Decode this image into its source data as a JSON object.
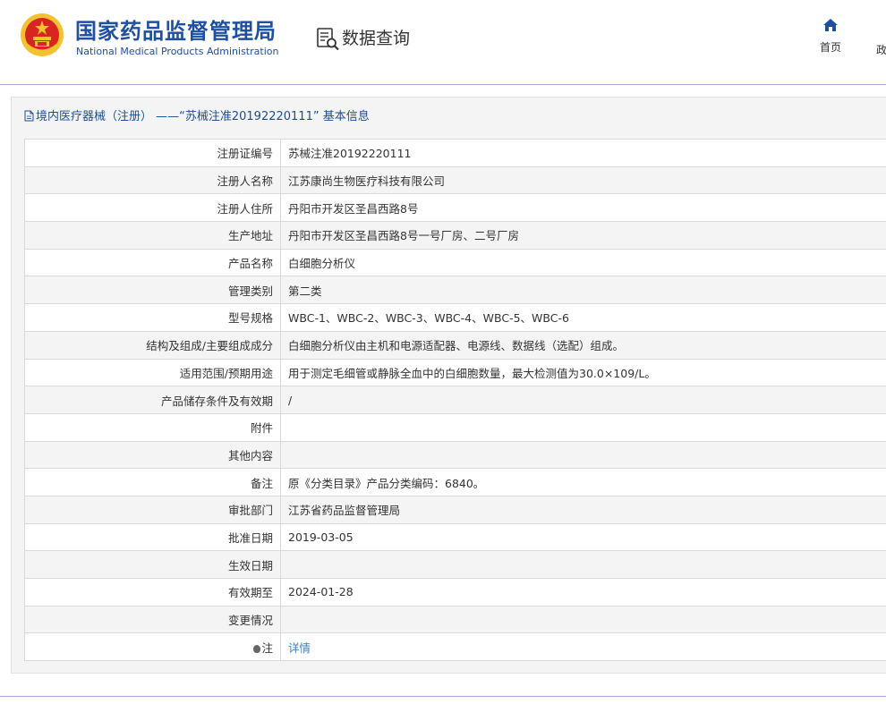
{
  "header": {
    "title_cn": "国家药品监督管理局",
    "title_en": "National Medical Products Administration",
    "query_label": "数据查询",
    "nav_home": "首页",
    "nav_next": "政"
  },
  "panel": {
    "title": "境内医疗器械（注册） ——“苏械注准20192220111” 基本信息"
  },
  "rows": [
    {
      "label": "注册证编号",
      "value": "苏械注准20192220111"
    },
    {
      "label": "注册人名称",
      "value": "江苏康尚生物医疗科技有限公司"
    },
    {
      "label": "注册人住所",
      "value": "丹阳市开发区圣昌西路8号"
    },
    {
      "label": "生产地址",
      "value": "丹阳市开发区圣昌西路8号一号厂房、二号厂房"
    },
    {
      "label": "产品名称",
      "value": "白细胞分析仪"
    },
    {
      "label": "管理类别",
      "value": "第二类"
    },
    {
      "label": "型号规格",
      "value": "WBC-1、WBC-2、WBC-3、WBC-4、WBC-5、WBC-6"
    },
    {
      "label": "结构及组成/主要组成成分",
      "value": "白细胞分析仪由主机和电源适配器、电源线、数据线（选配）组成。"
    },
    {
      "label": "适用范围/预期用途",
      "value": "用于测定毛细管或静脉全血中的白细胞数量，最大检测值为30.0×109/L。"
    },
    {
      "label": "产品储存条件及有效期",
      "value": "/"
    },
    {
      "label": "附件",
      "value": ""
    },
    {
      "label": "其他内容",
      "value": ""
    },
    {
      "label": "备注",
      "value": "原《分类目录》产品分类编码：6840。"
    },
    {
      "label": "审批部门",
      "value": "江苏省药品监督管理局"
    },
    {
      "label": "批准日期",
      "value": "2019-03-05"
    },
    {
      "label": "生效日期",
      "value": ""
    },
    {
      "label": "有效期至",
      "value": "2024-01-28"
    },
    {
      "label": "变更情况",
      "value": ""
    },
    {
      "label": "注",
      "value": "详情"
    }
  ],
  "colors": {
    "brand": "#1e4fa0",
    "link": "#3b7fc4",
    "emblem_red": "#d7261f",
    "emblem_gold": "#f2c230"
  },
  "icons": {
    "emblem": "national-emblem-icon",
    "query": "document-search-icon",
    "home": "home-icon",
    "doc": "document-icon",
    "note": "pin-dot-icon"
  }
}
